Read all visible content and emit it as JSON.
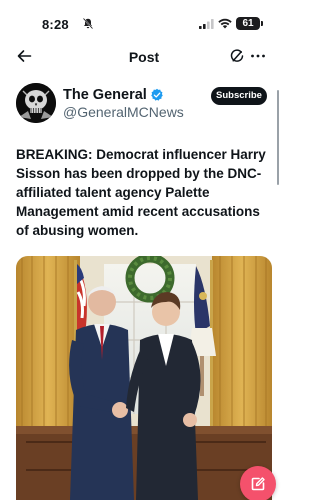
{
  "status_bar": {
    "time": "8:28",
    "battery": "61"
  },
  "nav": {
    "title": "Post"
  },
  "author": {
    "display_name": "The General",
    "handle": "@GeneralMCNews",
    "verified": true
  },
  "subscribe_label": "Subscribe",
  "post": {
    "text": "BREAKING: Democrat influencer Harry Sisson has been dropped by the DNC-affiliated talent agency Palette Management amid recent accusations of abusing women."
  },
  "colors": {
    "verified": "#1d9bf0",
    "compose_fab": "#f4516c"
  },
  "icons": {
    "back": "arrow-left-icon",
    "reply": "reply-icon",
    "more": "more-icon",
    "compose": "compose-icon",
    "bell": "bell-mute-icon"
  }
}
